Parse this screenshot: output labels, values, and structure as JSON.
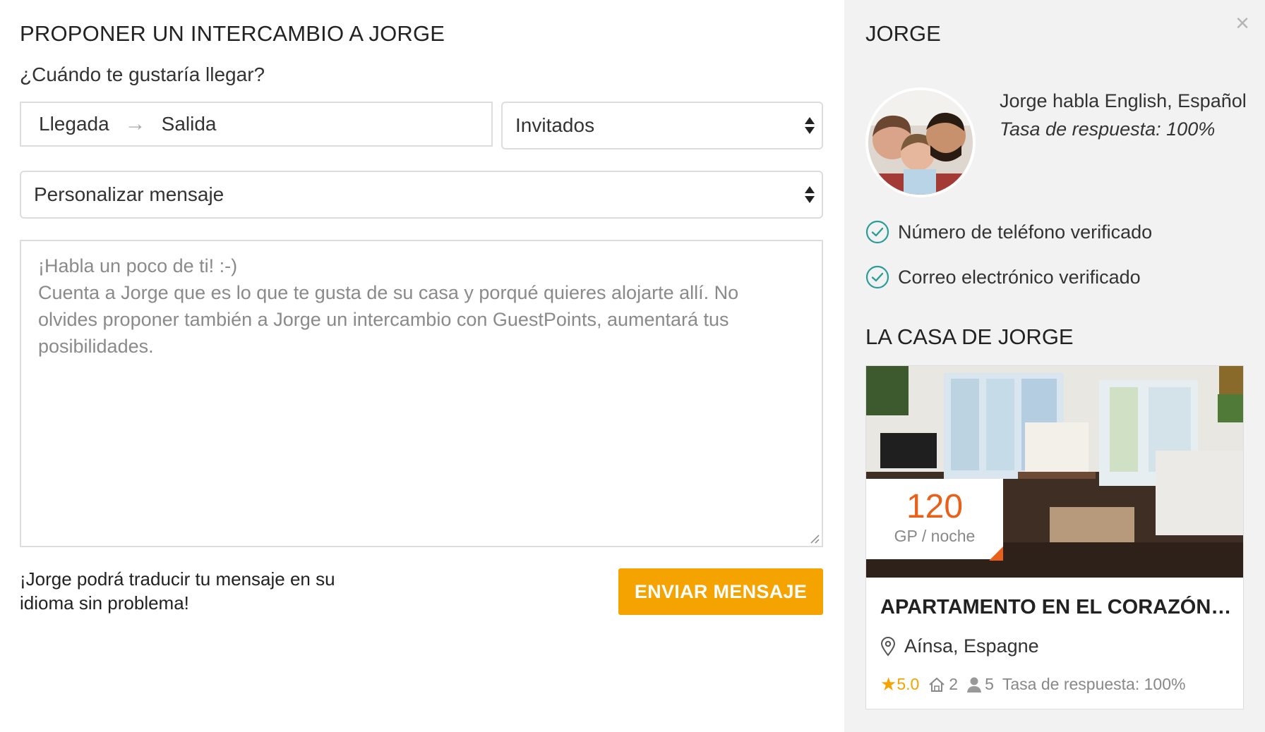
{
  "form": {
    "title": "PROPONER UN INTERCAMBIO A JORGE",
    "question": "¿Cuándo te gustaría llegar?",
    "arrival_label": "Llegada",
    "arrow": "→",
    "departure_label": "Salida",
    "guests_label": "Invitados",
    "custom_message_label": "Personalizar mensaje",
    "message_placeholder": "¡Habla un poco de ti! :-)\nCuenta a Jorge que es lo que te gusta de su casa y porqué quieres alojarte allí. No olvides proponer también a Jorge un intercambio con GuestPoints, aumentará tus posibilidades.",
    "translate_note": "¡Jorge podrá traducir tu mensaje en su idioma sin problema!",
    "send_label": "ENVIAR MENSAJE"
  },
  "host": {
    "close_icon": "×",
    "name": "JORGE",
    "languages": "Jorge habla English, Español",
    "response_rate": "Tasa de respuesta: 100%",
    "verifications": [
      "Número de teléfono verificado",
      "Correo electrónico verificado"
    ],
    "home_title": "LA CASA DE JORGE"
  },
  "listing": {
    "price": "120",
    "price_unit": "GP / noche",
    "title": "APARTAMENTO EN EL CORAZÓN ...",
    "location": "Aínsa, Espagne",
    "rating": "5.0",
    "rooms": "2",
    "guests": "5",
    "response_rate": "Tasa de respuesta: 100%"
  },
  "colors": {
    "accent": "#f5a300",
    "price": "#e8601a",
    "verified": "#2a9d9a"
  }
}
